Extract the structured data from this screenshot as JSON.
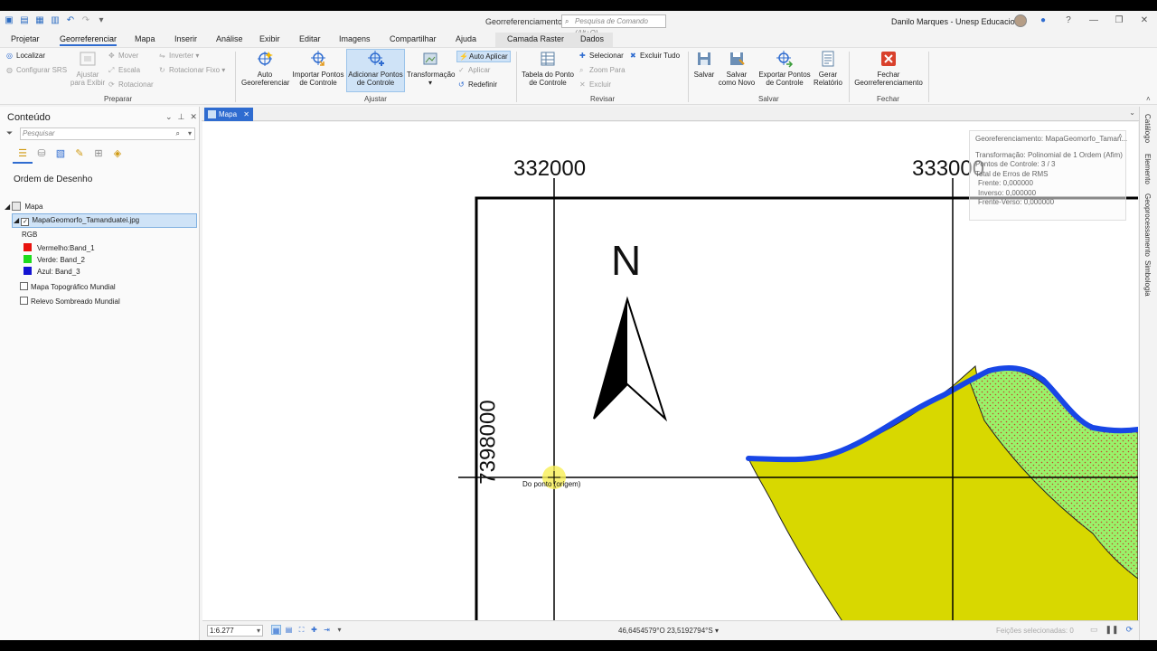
{
  "titlebar": {
    "title": "Georreferenciamento",
    "command_search_placeholder": "Pesquisa de Comando (Alt+Q)",
    "user": "Danilo Marques - Unesp Educacional"
  },
  "tabs": [
    "Projetar",
    "Georreferenciar",
    "Mapa",
    "Inserir",
    "Análise",
    "Exibir",
    "Editar",
    "Imagens",
    "Compartilhar",
    "Ajuda",
    "Camada Raster",
    "Dados"
  ],
  "active_tab": "Georreferenciar",
  "ribbon": {
    "prepare": {
      "label": "Preparar",
      "localizar": "Localizar",
      "configurar_srs": "Configurar SRS",
      "ajustar_exibir_1": "Ajustar",
      "ajustar_exibir_2": "para Exibir",
      "mover": "Mover",
      "escala": "Escala",
      "rotacionar": "Rotacionar",
      "inverter": "Inverter",
      "rotacionar_fixo": "Rotacionar Fixo"
    },
    "ajustar": {
      "label": "Ajustar",
      "auto_1": "Auto",
      "auto_2": "Georeferenciar",
      "importar_1": "Importar Pontos",
      "importar_2": "de Controle",
      "adicionar_1": "Adicionar Pontos",
      "adicionar_2": "de Controle",
      "transformacao": "Transformação",
      "auto_aplicar": "Auto Aplicar",
      "aplicar": "Aplicar",
      "redefinir": "Redefinir"
    },
    "revisar": {
      "label": "Revisar",
      "tabela_1": "Tabela do Ponto",
      "tabela_2": "de Controle",
      "selecionar": "Selecionar",
      "zoom_para": "Zoom Para",
      "excluir": "Excluir",
      "excluir_tudo": "Excluir Tudo"
    },
    "salvar": {
      "label": "Salvar",
      "salvar": "Salvar",
      "salvar_novo_1": "Salvar",
      "salvar_novo_2": "como Novo",
      "exportar_1": "Exportar Pontos",
      "exportar_2": "de Controle",
      "gerar_1": "Gerar",
      "gerar_2": "Relatório"
    },
    "fechar": {
      "label": "Fechar",
      "fechar_1": "Fechar",
      "fechar_2": "Georreferenciamento"
    }
  },
  "contents": {
    "title": "Conteúdo",
    "search_placeholder": "Pesquisar",
    "drawing_order": "Ordem de Desenho",
    "map": "Mapa",
    "layer": "MapaGeomorfo_Tamanduatei.jpg",
    "rgb": "RGB",
    "bands": [
      {
        "label": "Vermelho:Band_1",
        "color": "#e8120e"
      },
      {
        "label": "Verde: Band_2",
        "color": "#1edc1e"
      },
      {
        "label": "Azul:  Band_3",
        "color": "#1414d2"
      }
    ],
    "basemap_1": "Mapa Topográfico Mundial",
    "basemap_2": "Relevo Sombreado Mundial"
  },
  "map": {
    "tab": "Mapa",
    "easting_1": "332000",
    "easting_2": "333000",
    "northing": "7398000",
    "north": "N",
    "gcp_label": "Do ponto (origem)",
    "info_panel": {
      "title": "Georeferenciamento: MapaGeomorfo_Taman...",
      "transformacao": "Transformação: Polinomial de 1 Ordem (Afim)",
      "pontos": "Pontos de Controle: 3 / 3",
      "total_rms": "Total de Erros de RMS",
      "frente": "Frente: 0,000000",
      "inverso": "Inverso: 0,000000",
      "frente_verso": "Frente-Verso: 0,000000"
    }
  },
  "right_rail": [
    "Catálogo",
    "Elemento",
    "Geoprocessamento",
    "Simbologia"
  ],
  "statusbar": {
    "scale": "1:6.277",
    "coordinates": "46,6454579°O 23,5192794°S",
    "selected_features": "Feições selecionadas: 0"
  },
  "colors": {
    "accent": "#2f6cd0",
    "yellow_unit": "#d8d800",
    "green_unit": "#99f26a",
    "river": "#1846e6",
    "dots": "#c0492a"
  }
}
